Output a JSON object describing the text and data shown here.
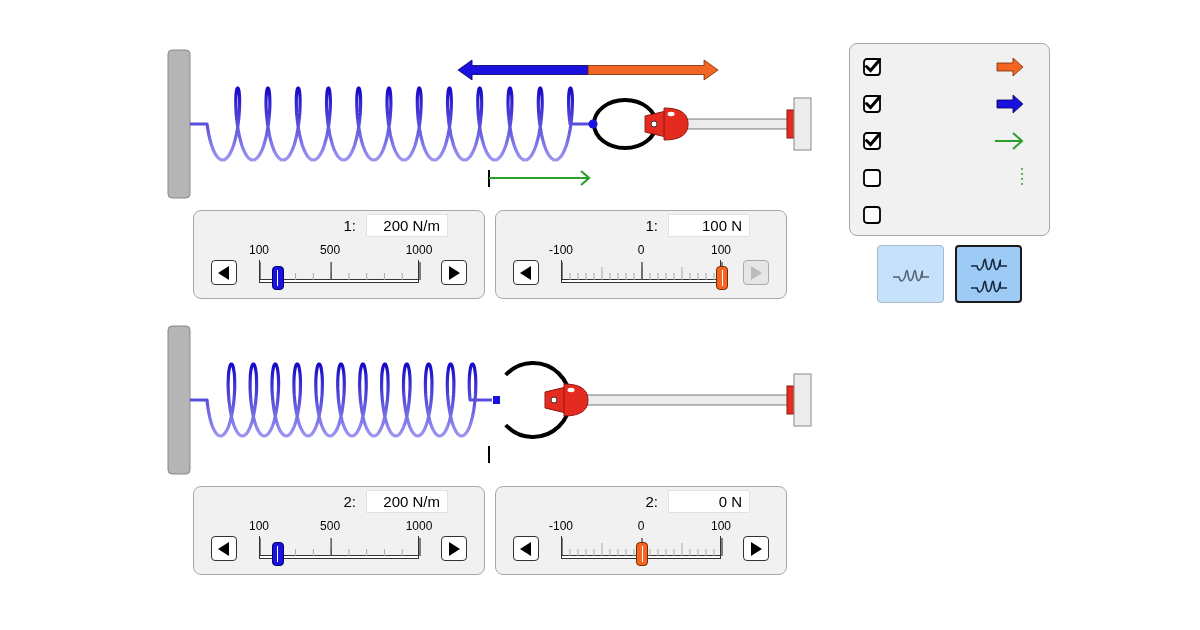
{
  "systems": [
    {
      "spring_constant": {
        "number": "1:",
        "value": "200 N/m",
        "level": 0.111,
        "ticks": [
          "100",
          "500",
          "1000"
        ],
        "decrease_disabled": false,
        "increase_disabled": false
      },
      "applied_force": {
        "number": "1:",
        "value": "100 N",
        "level": 1,
        "ticks": [
          "-100",
          "0",
          "100"
        ],
        "decrease_disabled": false,
        "increase_disabled": true
      }
    },
    {
      "spring_constant": {
        "number": "2:",
        "value": "200 N/m",
        "level": 0.111,
        "ticks": [
          "100",
          "500",
          "1000"
        ],
        "decrease_disabled": false,
        "increase_disabled": false
      },
      "applied_force": {
        "number": "2:",
        "value": "0 N",
        "level": 0.5,
        "ticks": [
          "-100",
          "0",
          "100"
        ],
        "decrease_disabled": false,
        "increase_disabled": false
      }
    }
  ],
  "visibility": [
    {
      "kind": "applied_force",
      "checked": true
    },
    {
      "kind": "spring_force",
      "checked": true
    },
    {
      "kind": "displacement",
      "checked": true
    },
    {
      "kind": "equilibrium",
      "checked": false
    },
    {
      "kind": "values",
      "checked": false
    }
  ],
  "modes": [
    {
      "kind": "single",
      "selected": false
    },
    {
      "kind": "double",
      "selected": true
    }
  ]
}
